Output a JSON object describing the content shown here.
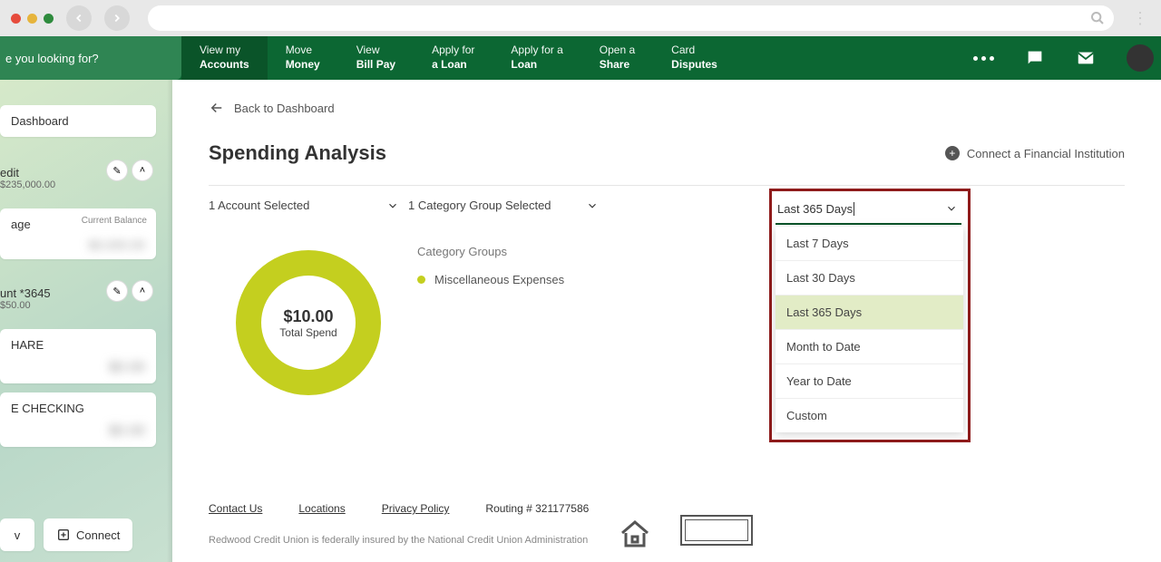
{
  "browser": {
    "search_aria": "Search"
  },
  "topnav": {
    "search_placeholder": "e you looking for?",
    "items": [
      {
        "l1": "View my",
        "l2": "Accounts",
        "active": true
      },
      {
        "l1": "Move",
        "l2": "Money"
      },
      {
        "l1": "View",
        "l2": "Bill Pay"
      },
      {
        "l1": "Apply for",
        "l2": "a Loan"
      },
      {
        "l1": "Apply for a",
        "l2": "Loan"
      },
      {
        "l1": "Open a",
        "l2": "Share"
      },
      {
        "l1": "Card",
        "l2": "Disputes"
      }
    ]
  },
  "sidebar": {
    "dashboard": "Dashboard",
    "credit": {
      "title": "edit",
      "sub": "$235,000.00"
    },
    "age_card": {
      "title": "age",
      "balance_label": "Current Balance"
    },
    "account": {
      "title": "unt *3645",
      "sub": "$50.00"
    },
    "share_card": "HARE",
    "checking_card": "E CHECKING",
    "btn_left": "v",
    "btn_connect": "Connect"
  },
  "main": {
    "back": "Back to Dashboard",
    "title": "Spending Analysis",
    "connect": "Connect a Financial Institution",
    "filters": {
      "accounts": "1 Account Selected",
      "categories": "1 Category Group Selected",
      "date": "Last 365 Days"
    },
    "donut": {
      "amount": "$10.00",
      "label": "Total Spend"
    },
    "cat_head": "Category Groups",
    "cat_item": "Miscellaneous Expenses",
    "dropdown": {
      "items": [
        "Last 7 Days",
        "Last 30 Days",
        "Last 365 Days",
        "Month to Date",
        "Year to Date",
        "Custom"
      ],
      "selected_index": 2
    }
  },
  "footer": {
    "links": [
      "Contact Us",
      "Locations",
      "Privacy Policy"
    ],
    "routing": "Routing # 321177586",
    "note": "Redwood Credit Union is federally insured by the National Credit Union Administration"
  },
  "chart_data": {
    "type": "pie",
    "title": "Total Spend",
    "series": [
      {
        "name": "Miscellaneous Expenses",
        "value": 10.0,
        "color": "#c4cf1f"
      }
    ],
    "total": 10.0,
    "currency": "USD"
  }
}
